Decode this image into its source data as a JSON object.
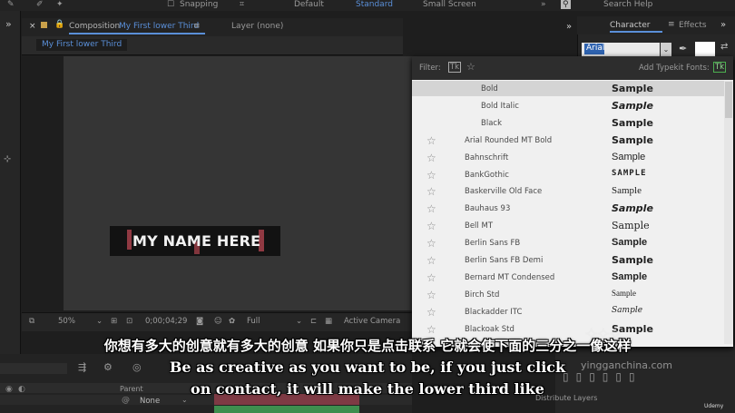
{
  "topbar": {
    "snapping": "Snapping",
    "workspace_default": "Default",
    "workspace_standard": "Standard",
    "workspace_small": "Small Screen",
    "search_help": "Search Help"
  },
  "composition": {
    "tab_prefix": "Composition",
    "tab_name": "My First lower Third",
    "layer_tab": "Layer (none)",
    "sub_tab": "My First lower Third",
    "lower_third_text": "MY NAME HERE"
  },
  "comp_toolbar": {
    "zoom": "50%",
    "timecode": "0;00;04;29",
    "resolution": "Full",
    "camera": "Active Camera"
  },
  "timeline": {
    "parent_label": "Parent",
    "parent_value": "None"
  },
  "character_panel": {
    "tab_character": "Character",
    "tab_effects": "Effects",
    "font_value": "Arial"
  },
  "font_menu": {
    "filter_label": "Filter:",
    "typekit_label": "Add Typekit Fonts:",
    "tk_icon": "Tk",
    "items": [
      {
        "name": "Bold",
        "sample": "Sample",
        "indent": true,
        "star": false,
        "selected": true
      },
      {
        "name": "Bold Italic",
        "sample": "Sample",
        "indent": true,
        "star": false
      },
      {
        "name": "Black",
        "sample": "Sample",
        "indent": true,
        "star": false
      },
      {
        "name": "Arial Rounded MT Bold",
        "sample": "Sample",
        "star": true
      },
      {
        "name": "Bahnschrift",
        "sample": "Sample",
        "star": true
      },
      {
        "name": "BankGothic",
        "sample": "SAMPLE",
        "star": true
      },
      {
        "name": "Baskerville Old Face",
        "sample": "Sample",
        "star": true
      },
      {
        "name": "Bauhaus 93",
        "sample": "Sample",
        "star": true
      },
      {
        "name": "Bell MT",
        "sample": "Sample",
        "star": true
      },
      {
        "name": "Berlin Sans FB",
        "sample": "Sample",
        "star": true
      },
      {
        "name": "Berlin Sans FB Demi",
        "sample": "Sample",
        "star": true
      },
      {
        "name": "Bernard MT Condensed",
        "sample": "Sample",
        "star": true
      },
      {
        "name": "Birch Std",
        "sample": "Sample",
        "star": true
      },
      {
        "name": "Blackadder ITC",
        "sample": "Sample",
        "star": true
      },
      {
        "name": "Blackoak Std",
        "sample": "Sample",
        "star": true
      }
    ]
  },
  "subtitles": {
    "chinese": "你想有多大的创意就有多大的创意 如果你只是点击联系 它就会使下面的三分之一像这样",
    "english_line1": "Be as creative as you want to be, if you just click",
    "english_line2": "on contact, it will make the lower third like"
  },
  "watermark": {
    "site": "yingganchina.com",
    "brand": "Udemy",
    "distribute_layers": "Distribute Layers"
  }
}
